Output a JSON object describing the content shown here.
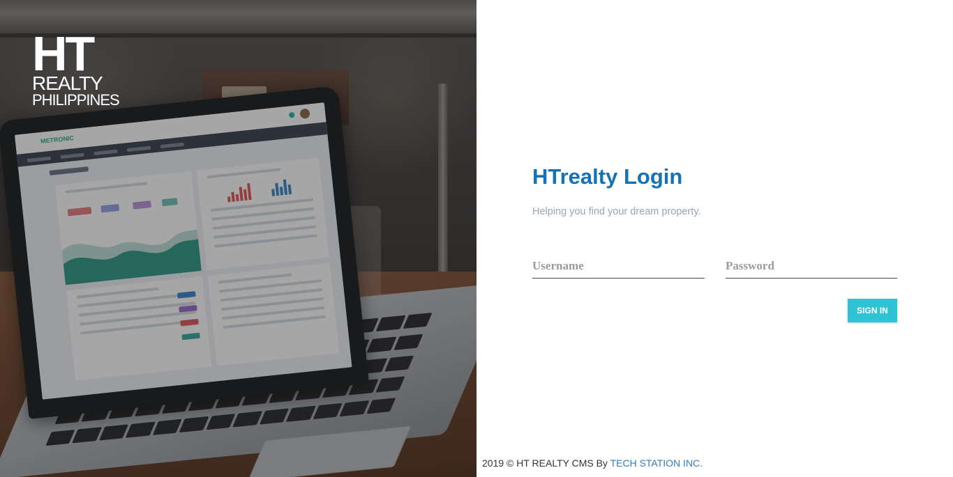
{
  "brand": {
    "logo_line1": "HT",
    "logo_line2": "REALTY",
    "logo_line3": "PHILIPPINES"
  },
  "login": {
    "title": "HTrealty Login",
    "tagline": "Helping you find your dream property.",
    "username_placeholder": "Username",
    "password_placeholder": "Password",
    "signin_label": "SIGN IN"
  },
  "footer": {
    "text": "2019 © HT REALTY CMS By",
    "link_text": "TECH STATION INC."
  },
  "background_screen": {
    "brand": "METRONIC"
  },
  "colors": {
    "title": "#1473b5",
    "tagline": "#9aa5b1",
    "button": "#2ec4d6",
    "link": "#337ab7"
  }
}
